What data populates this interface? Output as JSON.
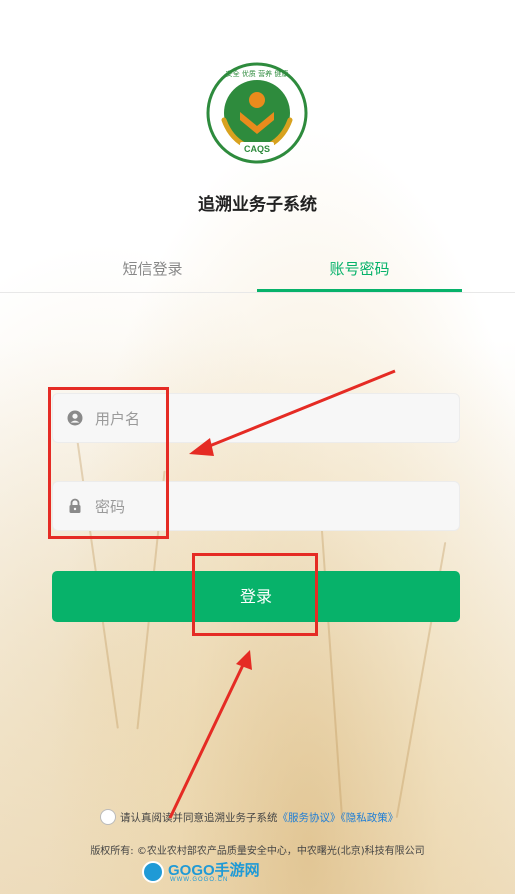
{
  "logo": {
    "arc_text": "安全 优质 营养 健康",
    "badge_text": "CAQS",
    "colors": {
      "green": "#2e8b3d",
      "orange": "#e98b1c",
      "gold": "#d8a21f"
    }
  },
  "app_title": "追溯业务子系统",
  "tabs": [
    {
      "label": "短信登录",
      "active": false
    },
    {
      "label": "账号密码",
      "active": true
    }
  ],
  "form": {
    "username_placeholder": "用户名",
    "password_placeholder": "密码",
    "login_label": "登录"
  },
  "agreement": {
    "prefix": "请认真阅读并同意追溯业务子系统",
    "service_link": "《服务协议》",
    "privacy_link": "《隐私政策》"
  },
  "copyright": "版权所有: ©农业农村部农产品质量安全中心，中农曙光(北京)科技有限公司",
  "watermark": {
    "brand": "GOGO手游网",
    "domain": "WWW.GOGO.CN"
  },
  "colors": {
    "accent": "#07b26a",
    "link": "#1d7dd6",
    "annotation_red": "#e52b24"
  }
}
